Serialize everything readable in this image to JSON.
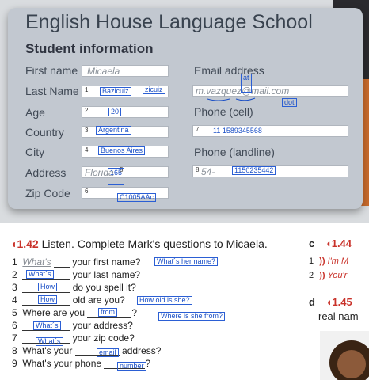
{
  "card": {
    "school_title": "English House Language School",
    "section_title": "Student information"
  },
  "form": {
    "first_name_label": "First name",
    "first_name_value": "Micaela",
    "last_name_label": "Last Name",
    "last_name_num": "1",
    "last_name_ink": "Bazicuiz",
    "last_name_ink2": "zicuiz",
    "age_label": "Age",
    "age_num": "2",
    "age_ink": "20",
    "country_label": "Country",
    "country_num": "3",
    "country_ink": "Argentina",
    "city_label": "City",
    "city_num": "4",
    "city_ink": "Buenos Aires",
    "address_label": "Address",
    "address_value": "Florida",
    "address_num": "5",
    "address_ink": "165",
    "zip_label": "Zip Code",
    "zip_num": "6",
    "zip_ink": "C1005AAc",
    "email_label": "Email address",
    "email_value": "m.vazquez@mail.com",
    "email_ink_at": "at",
    "email_ink_dot": "dot",
    "cell_label": "Phone (cell)",
    "cell_num": "7",
    "cell_ink": "11 1589345568",
    "landline_label": "Phone (landline)",
    "landline_num": "8",
    "landline_value": "54-",
    "landline_ink": "1150235442"
  },
  "exercise": {
    "number": "1.42",
    "instruction": "Listen. Complete Mark's questions to Micaela.",
    "q1": {
      "n": "1",
      "pre": "What's",
      "text": "your first name?",
      "ink": "What´s her name?"
    },
    "q2": {
      "n": "2",
      "ink": "What´s",
      "text": "your last name?"
    },
    "q3": {
      "n": "3",
      "ink": "How",
      "text": "do you spell it?"
    },
    "q4": {
      "n": "4",
      "ink": "How",
      "text": "old are you?",
      "ink2": "How old is she?"
    },
    "q5": {
      "n": "5",
      "text": "Where are you",
      "ink": "from",
      "end": "?",
      "ink2": "Where is she from?"
    },
    "q6": {
      "n": "6",
      "ink": "What´s",
      "text": "your address?"
    },
    "q7": {
      "n": "7",
      "ink": "What´s",
      "text": "your zip code?"
    },
    "q8": {
      "n": "8",
      "text": "What's your",
      "ink": "email",
      "end": "address?"
    },
    "q9": {
      "n": "9",
      "text": "What's your phone",
      "ink": "number",
      "end": "?"
    }
  },
  "right_column": {
    "c_letter": "c",
    "c_num": "1.44",
    "c_line1_n": "1",
    "c_line1": "I'm M",
    "c_line2_n": "2",
    "c_line2": "You'r",
    "d_letter": "d",
    "d_num": "1.45",
    "d_line": "real nam"
  },
  "colors": {
    "ink": "#1a4fc6",
    "accent_red": "#c9322a",
    "card": "#c2c8d0"
  }
}
